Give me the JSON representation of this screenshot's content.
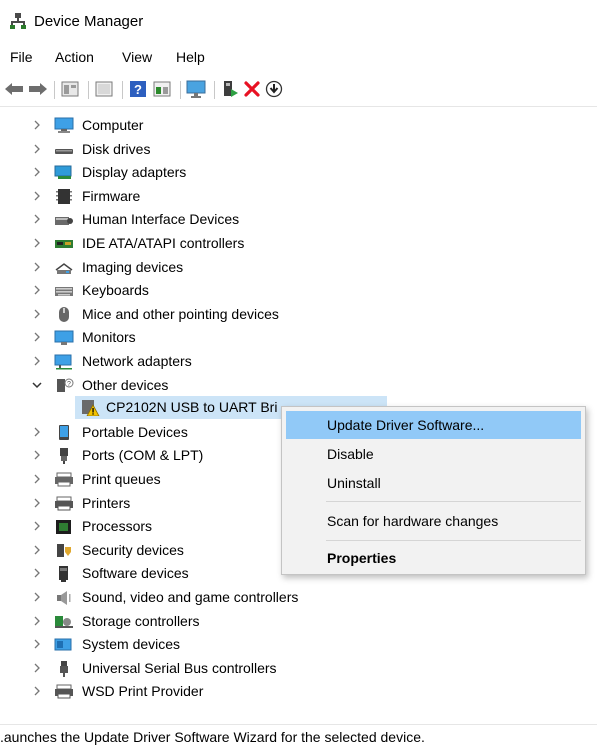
{
  "window": {
    "title": "Device Manager"
  },
  "menubar": [
    "File",
    "Action",
    "View",
    "Help"
  ],
  "toolbar": [
    "back-arrow-icon",
    "forward-arrow-icon",
    "properties-icon",
    "show-hidden-icon",
    "help-icon",
    "computer-view-icon",
    "scan-monitor-icon",
    "add-driver-icon",
    "remove-device-icon",
    "download-icon"
  ],
  "tree": {
    "items": [
      {
        "label": "Computer",
        "icon": "computer-icon"
      },
      {
        "label": "Disk drives",
        "icon": "disk-drive-icon"
      },
      {
        "label": "Display adapters",
        "icon": "display-adapter-icon"
      },
      {
        "label": "Firmware",
        "icon": "firmware-icon"
      },
      {
        "label": "Human Interface Devices",
        "icon": "hid-icon"
      },
      {
        "label": "IDE ATA/ATAPI controllers",
        "icon": "ide-controller-icon"
      },
      {
        "label": "Imaging devices",
        "icon": "imaging-icon"
      },
      {
        "label": "Keyboards",
        "icon": "keyboard-icon"
      },
      {
        "label": "Mice and other pointing devices",
        "icon": "mouse-icon"
      },
      {
        "label": "Monitors",
        "icon": "monitor-icon"
      },
      {
        "label": "Network adapters",
        "icon": "network-icon"
      },
      {
        "label": "Other devices",
        "icon": "other-devices-icon",
        "expanded": true
      },
      {
        "label": "Portable Devices",
        "icon": "portable-device-icon"
      },
      {
        "label": "Ports (COM & LPT)",
        "icon": "port-icon"
      },
      {
        "label": "Print queues",
        "icon": "print-queue-icon"
      },
      {
        "label": "Printers",
        "icon": "printer-icon"
      },
      {
        "label": "Processors",
        "icon": "processor-icon"
      },
      {
        "label": "Security devices",
        "icon": "security-icon"
      },
      {
        "label": "Software devices",
        "icon": "software-device-icon"
      },
      {
        "label": "Sound, video and game controllers",
        "icon": "sound-icon"
      },
      {
        "label": "Storage controllers",
        "icon": "storage-icon"
      },
      {
        "label": "System devices",
        "icon": "system-devices-icon"
      },
      {
        "label": "Universal Serial Bus controllers",
        "icon": "usb-icon"
      },
      {
        "label": "WSD Print Provider",
        "icon": "wsd-printer-icon"
      }
    ],
    "selected_child": {
      "label": "CP2102N USB to UART Bri",
      "icon": "warning-device-icon"
    }
  },
  "context_menu": {
    "items": [
      {
        "label": "Update Driver Software...",
        "highlighted": true
      },
      {
        "label": "Disable"
      },
      {
        "label": "Uninstall"
      },
      {
        "label": "Scan for hardware changes"
      },
      {
        "label": "Properties",
        "bold": true
      }
    ]
  },
  "status": {
    "text": ".aunches the Update Driver Software Wizard for the selected device."
  },
  "colors": {
    "selection": "#cce4f7",
    "menu_highlight": "#91c9f7",
    "remove_x": "#e81123"
  }
}
